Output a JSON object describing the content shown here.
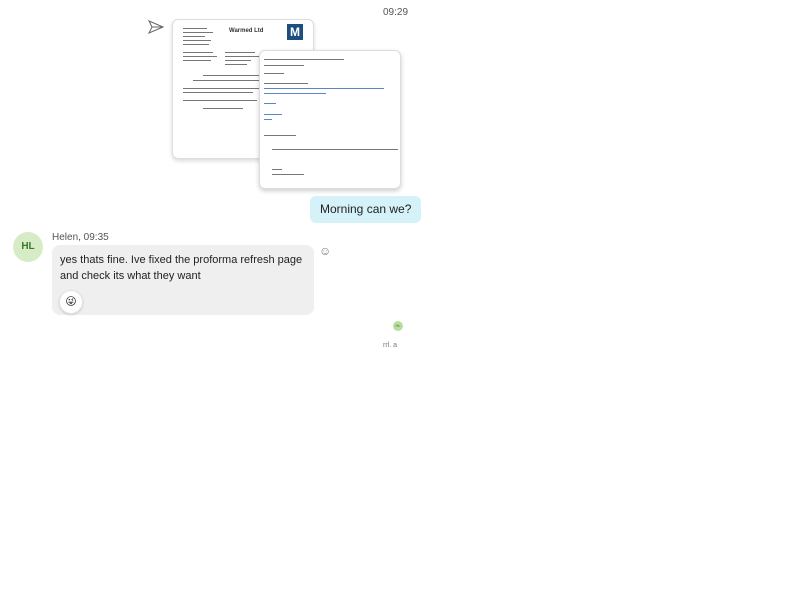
{
  "outgoing": {
    "time": "09:29",
    "attachment_doc1": {
      "company": "Warmed Ltd",
      "logo_letter": "M"
    },
    "message": "Morning can we?"
  },
  "incoming": {
    "avatar_initials": "HL",
    "sender_time": "Helen, 09:35",
    "message": "yes thats fine. Ive fixed the proforma refresh page and check its what they want",
    "reaction": "😜"
  },
  "read_receipt": {
    "initials": "HL"
  },
  "status_text": "rrl. a"
}
